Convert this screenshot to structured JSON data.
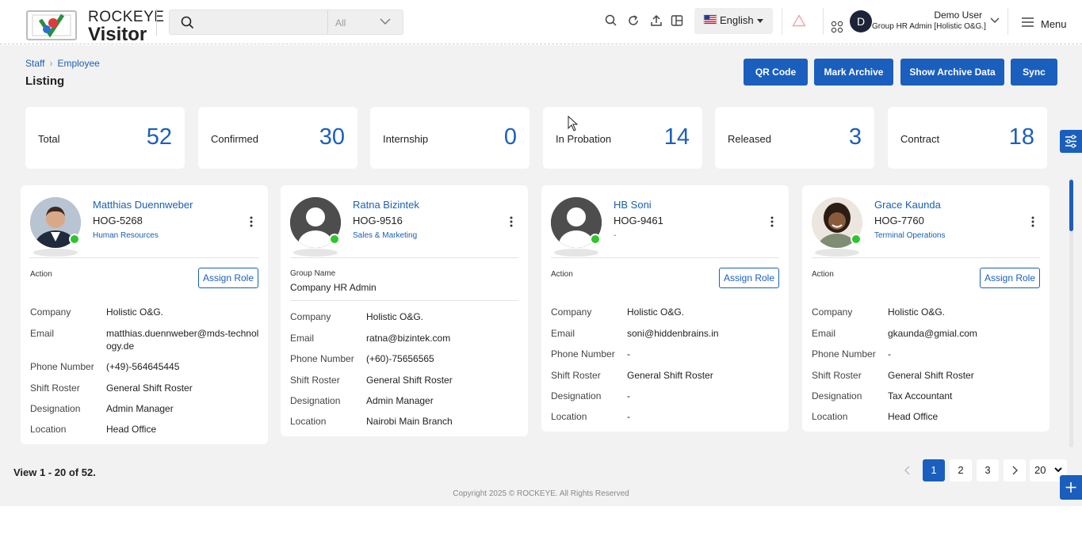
{
  "header": {
    "brand_top": "ROCKEYE",
    "brand_bottom": "Visitor",
    "search": {
      "placeholder": "",
      "filter_value": "All"
    },
    "language": "English",
    "user": {
      "initial": "D",
      "name": "Demo User",
      "role": "Group HR Admin [Holistic O&G.]"
    },
    "menu_label": "Menu"
  },
  "breadcrumb": {
    "items": [
      "Staff",
      "Employee"
    ]
  },
  "page_title": "Listing",
  "actions": {
    "qr": "QR Code",
    "mark_archive": "Mark Archive",
    "show_archive": "Show Archive Data",
    "sync": "Sync"
  },
  "stats": [
    {
      "label": "Total",
      "value": "52"
    },
    {
      "label": "Confirmed",
      "value": "30"
    },
    {
      "label": "Internship",
      "value": "0"
    },
    {
      "label": "In Probation",
      "value": "14"
    },
    {
      "label": "Released",
      "value": "3"
    },
    {
      "label": "Contract",
      "value": "18"
    }
  ],
  "field_labels": {
    "action": "Action",
    "group_name": "Group Name",
    "company": "Company",
    "email": "Email",
    "phone": "Phone Number",
    "shift": "Shift Roster",
    "designation": "Designation",
    "location": "Location",
    "assign_role": "Assign Role"
  },
  "employees": [
    {
      "name": "Matthias Duennweber",
      "code": "HOG-5268",
      "department": "Human Resources",
      "company": "Holistic O&G.",
      "email": "matthias.duennweber@mds-technology.de",
      "phone": "(+49)-564645445",
      "shift": "General Shift Roster",
      "designation": "Admin Manager",
      "location": "Head Office"
    },
    {
      "name": "Ratna Bizintek",
      "code": "HOG-9516",
      "department": "Sales & Marketing",
      "group_name": "Company HR Admin",
      "company": "Holistic O&G.",
      "email": "ratna@bizintek.com",
      "phone": "(+60)-75656565",
      "shift": "General Shift Roster",
      "designation": "Admin Manager",
      "location": "Nairobi Main Branch"
    },
    {
      "name": "HB Soni",
      "code": "HOG-9461",
      "department": "-",
      "company": "Holistic O&G.",
      "email": "soni@hiddenbrains.in",
      "phone": "-",
      "shift": "General Shift Roster",
      "designation": "-",
      "location": "-"
    },
    {
      "name": "Grace Kaunda",
      "code": "HOG-7760",
      "department": "Terminal Operations",
      "company": "Holistic O&G.",
      "email": "gkaunda@gmial.com",
      "phone": "-",
      "shift": "General Shift Roster",
      "designation": "Tax Accountant",
      "location": "Head Office"
    }
  ],
  "pagination": {
    "view_text": "View 1 - 20 of 52.",
    "pages": [
      "1",
      "2",
      "3"
    ],
    "page_size": "20"
  },
  "footer": {
    "copyright": "Copyright 2025 © ROCKEYE. All Rights Reserved"
  },
  "colors": {
    "primary": "#1b5fbe",
    "online": "#2ec42e",
    "background": "#f2f2f2"
  }
}
